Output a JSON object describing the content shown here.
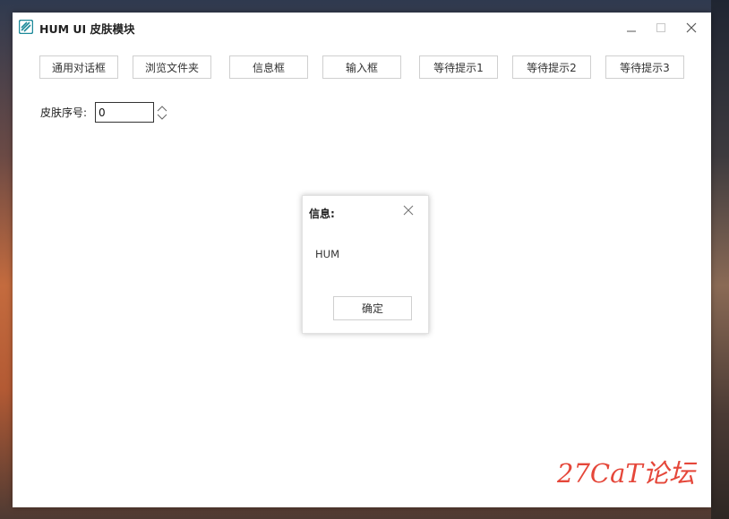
{
  "window": {
    "title": "HUM UI 皮肤模块"
  },
  "toolbar": {
    "buttons": [
      {
        "label": "通用对话框"
      },
      {
        "label": "浏览文件夹"
      },
      {
        "label": "信息框"
      },
      {
        "label": "输入框"
      },
      {
        "label": "等待提示1"
      },
      {
        "label": "等待提示2"
      },
      {
        "label": "等待提示3"
      }
    ]
  },
  "skin": {
    "label": "皮肤序号:",
    "value": "0"
  },
  "dialog": {
    "title": "信息:",
    "message": "HUM",
    "ok_label": "确定"
  },
  "watermark": {
    "text": "27CaT论坛"
  },
  "colors": {
    "accent": "#1e8a9a",
    "watermark": "#e5473a"
  }
}
